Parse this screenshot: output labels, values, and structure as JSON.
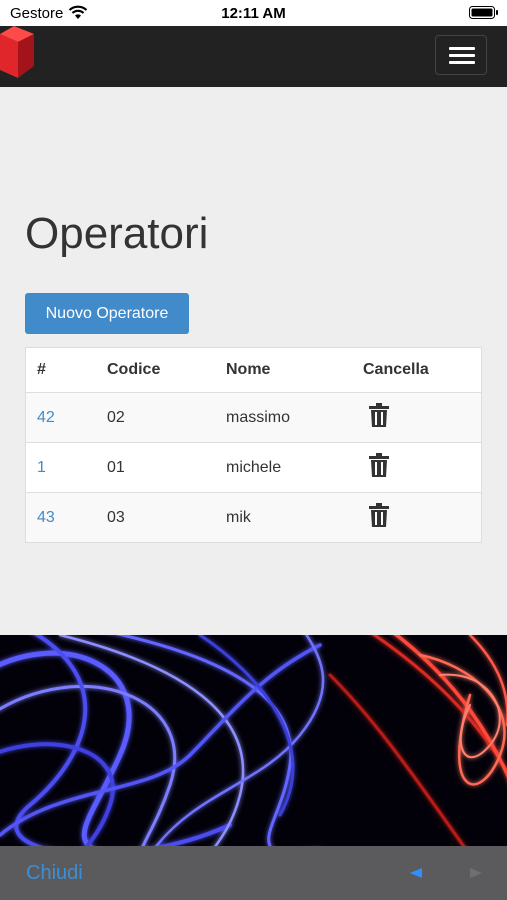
{
  "status": {
    "carrier": "Gestore",
    "time": "12:11 AM"
  },
  "page": {
    "title": "Operatori",
    "new_button": "Nuovo Operatore"
  },
  "table": {
    "headers": [
      "#",
      "Codice",
      "Nome",
      "Cancella"
    ],
    "rows": [
      {
        "id": "42",
        "codice": "02",
        "nome": "massimo"
      },
      {
        "id": "1",
        "codice": "01",
        "nome": "michele"
      },
      {
        "id": "43",
        "codice": "03",
        "nome": "mik"
      }
    ]
  },
  "bottom": {
    "close_label": "Chiudi"
  },
  "colors": {
    "navbar": "#222222",
    "primary": "#428bca",
    "logo": "#e0252b",
    "link": "#428bca"
  },
  "icons": [
    "wifi-icon",
    "battery-icon",
    "logo-cube-icon",
    "hamburger-menu-icon",
    "trash-icon",
    "back-arrow-icon",
    "forward-arrow-icon"
  ]
}
